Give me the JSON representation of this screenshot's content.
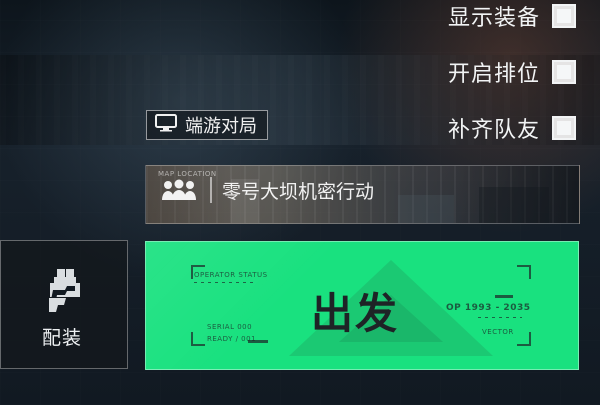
{
  "options": [
    {
      "label": "显示装备"
    },
    {
      "label": "开启排位"
    },
    {
      "label": "补齐队友"
    }
  ],
  "pc_mode": {
    "label": "端游对局",
    "icon": "monitor-icon"
  },
  "mission": {
    "title": "零号大坝机密行动",
    "icon": "team-icon",
    "tiny_text": "MAP LOCATION"
  },
  "equip": {
    "label": "配装",
    "icon": "loadout-icon"
  },
  "depart": {
    "label": "出发",
    "hud_top_left": "OPERATOR STATUS",
    "hud_bottom_left_1": "SERIAL 000",
    "hud_bottom_left_2": "READY / 001",
    "hud_right": "OP 1993 - 2035",
    "hud_right_sub": "VECTOR",
    "accent_color": "#19e17f"
  }
}
